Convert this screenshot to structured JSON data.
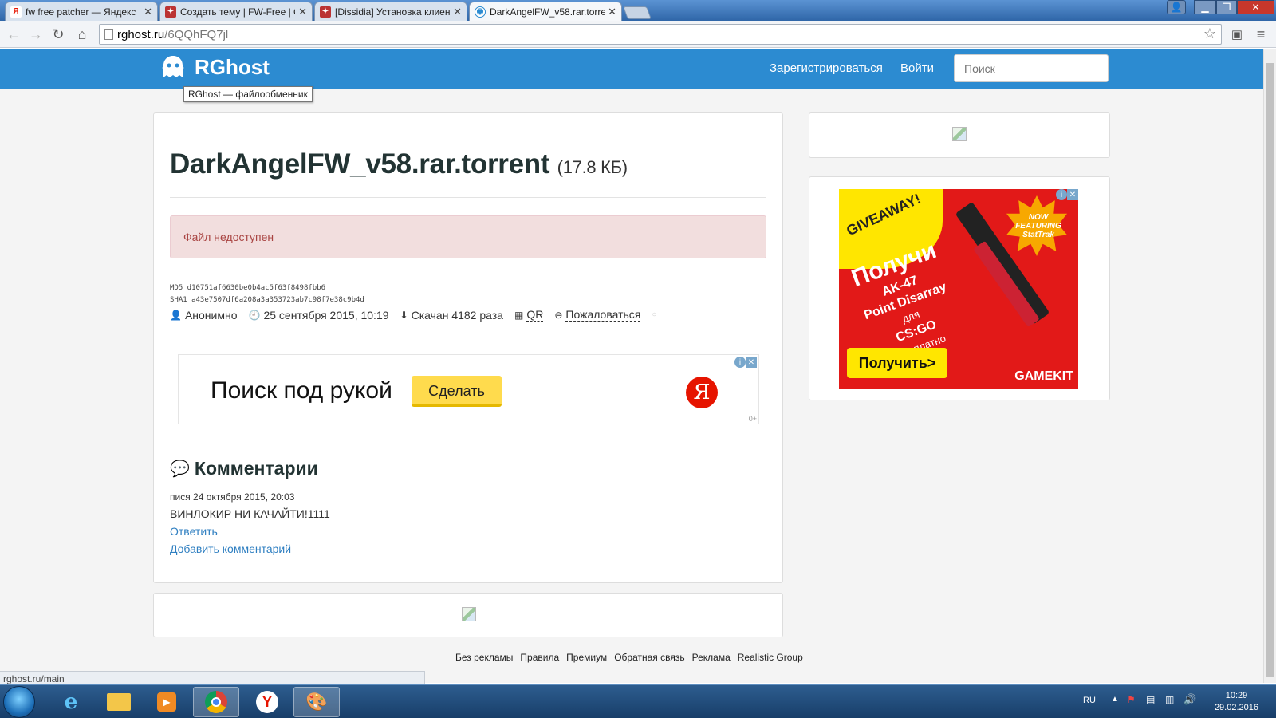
{
  "browser": {
    "tabs": [
      {
        "title": "fw free patcher — Яндекс",
        "favicon": "Я",
        "active": false
      },
      {
        "title": "Создать тему | FW-Free | С",
        "favicon": "",
        "active": false
      },
      {
        "title": "[Dissidia] Установка клиен",
        "favicon": "",
        "active": false
      },
      {
        "title": "DarkAngelFW_v58.rar.torre",
        "favicon": "",
        "active": true
      }
    ],
    "address": {
      "host": "rghost.ru",
      "path": "/6QQhFQ7jl"
    },
    "status_url": "rghost.ru/main"
  },
  "header": {
    "logo_text": "RGhost",
    "logo_tooltip": "RGhost — файлообменник",
    "register_label": "Зарегистрироваться",
    "login_label": "Войти",
    "search_placeholder": "Поиск",
    "bar_color": "#2c8bd1"
  },
  "file": {
    "name": "DarkAngelFW_v58.rar.torrent",
    "size": "(17.8 КБ)",
    "alert": "Файл недоступен",
    "md5": "MD5  d10751af6630be0b4ac5f63f8498fbb6",
    "sha1": "SHA1 a43e7507df6a208a3a353723ab7c98f7e38c9b4d",
    "author": "Анонимно",
    "date": "25 сентября 2015, 10:19",
    "downloads": "Скачан 4182 раза",
    "qr_label": "QR",
    "report_label": "Пожаловаться"
  },
  "yandex_ad": {
    "text": "Поиск под рукой",
    "button": "Сделать",
    "logo": "Я",
    "age": "0+"
  },
  "comments": {
    "heading": "Комментарии",
    "items": [
      {
        "author": "пися",
        "date": "24 октября 2015, 20:03",
        "text": "ВИНЛОКИР НИ КАЧАЙТИ!1111"
      }
    ],
    "reply_label": "Ответить",
    "add_label": "Добавить комментарий"
  },
  "gamekit_ad": {
    "giveaway": "GIVEAWAY!",
    "headline": "Получи",
    "line1": "AK-47",
    "line2": "Point Disarray",
    "line3": "для",
    "line4": "CS:GO",
    "line5": "бесплатно",
    "badge": "NOW FEATURING StatTrak",
    "cta": "Получить>",
    "brand": "GAMEKIT"
  },
  "footer": {
    "links": [
      "Без рекламы",
      "Правила",
      "Премиум",
      "Обратная связь",
      "Реклама",
      "Realistic Group"
    ]
  },
  "taskbar": {
    "language": "RU",
    "time": "10:29",
    "date": "29.02.2016"
  }
}
